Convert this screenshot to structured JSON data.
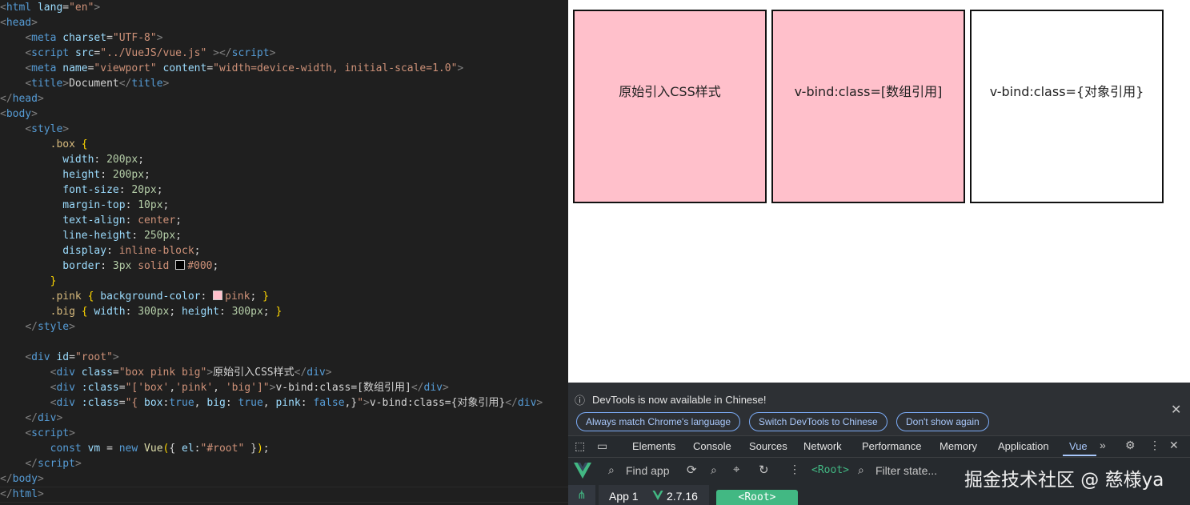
{
  "editor": {
    "lines": [
      [
        {
          "c": "br",
          "t": "<"
        },
        {
          "c": "tg",
          "t": "html"
        },
        {
          "c": "tx",
          "t": " "
        },
        {
          "c": "at",
          "t": "lang"
        },
        {
          "c": "tx",
          "t": "="
        },
        {
          "c": "st",
          "t": "\"en\""
        },
        {
          "c": "br",
          "t": ">"
        }
      ],
      [
        {
          "c": "br",
          "t": "<"
        },
        {
          "c": "tg",
          "t": "head"
        },
        {
          "c": "br",
          "t": ">"
        }
      ],
      [
        {
          "c": "tx",
          "t": "    "
        },
        {
          "c": "br",
          "t": "<"
        },
        {
          "c": "tg",
          "t": "meta"
        },
        {
          "c": "tx",
          "t": " "
        },
        {
          "c": "at",
          "t": "charset"
        },
        {
          "c": "tx",
          "t": "="
        },
        {
          "c": "st",
          "t": "\"UTF-8\""
        },
        {
          "c": "br",
          "t": ">"
        }
      ],
      [
        {
          "c": "tx",
          "t": "    "
        },
        {
          "c": "br",
          "t": "<"
        },
        {
          "c": "tg",
          "t": "script"
        },
        {
          "c": "tx",
          "t": " "
        },
        {
          "c": "at",
          "t": "src"
        },
        {
          "c": "tx",
          "t": "="
        },
        {
          "c": "st",
          "t": "\"../VueJS/vue.js\""
        },
        {
          "c": "tx",
          "t": " "
        },
        {
          "c": "br",
          "t": "></"
        },
        {
          "c": "tg",
          "t": "script"
        },
        {
          "c": "br",
          "t": ">"
        }
      ],
      [
        {
          "c": "tx",
          "t": "    "
        },
        {
          "c": "br",
          "t": "<"
        },
        {
          "c": "tg",
          "t": "meta"
        },
        {
          "c": "tx",
          "t": " "
        },
        {
          "c": "at",
          "t": "name"
        },
        {
          "c": "tx",
          "t": "="
        },
        {
          "c": "st",
          "t": "\"viewport\""
        },
        {
          "c": "tx",
          "t": " "
        },
        {
          "c": "at",
          "t": "content"
        },
        {
          "c": "tx",
          "t": "="
        },
        {
          "c": "st",
          "t": "\"width=device-width, initial-scale=1.0\""
        },
        {
          "c": "br",
          "t": ">"
        }
      ],
      [
        {
          "c": "tx",
          "t": "    "
        },
        {
          "c": "br",
          "t": "<"
        },
        {
          "c": "tg",
          "t": "title"
        },
        {
          "c": "br",
          "t": ">"
        },
        {
          "c": "tx",
          "t": "Document"
        },
        {
          "c": "br",
          "t": "</"
        },
        {
          "c": "tg",
          "t": "title"
        },
        {
          "c": "br",
          "t": ">"
        }
      ],
      [
        {
          "c": "br",
          "t": "</"
        },
        {
          "c": "tg",
          "t": "head"
        },
        {
          "c": "br",
          "t": ">"
        }
      ],
      [
        {
          "c": "br",
          "t": "<"
        },
        {
          "c": "tg",
          "t": "body"
        },
        {
          "c": "br",
          "t": ">"
        }
      ],
      [
        {
          "c": "tx",
          "t": "    "
        },
        {
          "c": "br",
          "t": "<"
        },
        {
          "c": "tg",
          "t": "style"
        },
        {
          "c": "br",
          "t": ">"
        }
      ],
      [
        {
          "c": "tx",
          "t": "        "
        },
        {
          "c": "sel",
          "t": ".box"
        },
        {
          "c": "tx",
          "t": " "
        },
        {
          "c": "pu",
          "t": "{"
        }
      ],
      [
        {
          "c": "tx",
          "t": "          "
        },
        {
          "c": "pr",
          "t": "width"
        },
        {
          "c": "tx",
          "t": ": "
        },
        {
          "c": "nu",
          "t": "200px"
        },
        {
          "c": "tx",
          "t": ";"
        }
      ],
      [
        {
          "c": "tx",
          "t": "          "
        },
        {
          "c": "pr",
          "t": "height"
        },
        {
          "c": "tx",
          "t": ": "
        },
        {
          "c": "nu",
          "t": "200px"
        },
        {
          "c": "tx",
          "t": ";"
        }
      ],
      [
        {
          "c": "tx",
          "t": "          "
        },
        {
          "c": "pr",
          "t": "font-size"
        },
        {
          "c": "tx",
          "t": ": "
        },
        {
          "c": "nu",
          "t": "20px"
        },
        {
          "c": "tx",
          "t": ";"
        }
      ],
      [
        {
          "c": "tx",
          "t": "          "
        },
        {
          "c": "pr",
          "t": "margin-top"
        },
        {
          "c": "tx",
          "t": ": "
        },
        {
          "c": "nu",
          "t": "10px"
        },
        {
          "c": "tx",
          "t": ";"
        }
      ],
      [
        {
          "c": "tx",
          "t": "          "
        },
        {
          "c": "pr",
          "t": "text-align"
        },
        {
          "c": "tx",
          "t": ": "
        },
        {
          "c": "vl",
          "t": "center"
        },
        {
          "c": "tx",
          "t": ";"
        }
      ],
      [
        {
          "c": "tx",
          "t": "          "
        },
        {
          "c": "pr",
          "t": "line-height"
        },
        {
          "c": "tx",
          "t": ": "
        },
        {
          "c": "nu",
          "t": "250px"
        },
        {
          "c": "tx",
          "t": ";"
        }
      ],
      [
        {
          "c": "tx",
          "t": "          "
        },
        {
          "c": "pr",
          "t": "display"
        },
        {
          "c": "tx",
          "t": ": "
        },
        {
          "c": "vl",
          "t": "inline-block"
        },
        {
          "c": "tx",
          "t": ";"
        }
      ],
      [
        {
          "c": "tx",
          "t": "          "
        },
        {
          "c": "pr",
          "t": "border"
        },
        {
          "c": "tx",
          "t": ": "
        },
        {
          "c": "nu",
          "t": "3px"
        },
        {
          "c": "tx",
          "t": " "
        },
        {
          "c": "vl",
          "t": "solid"
        },
        {
          "c": "tx",
          "t": " "
        },
        {
          "c": "sw",
          "t": "#000000"
        },
        {
          "c": "vl",
          "t": "#000"
        },
        {
          "c": "tx",
          "t": ";"
        }
      ],
      [
        {
          "c": "tx",
          "t": "        "
        },
        {
          "c": "pu",
          "t": "}"
        }
      ],
      [
        {
          "c": "tx",
          "t": "        "
        },
        {
          "c": "sel",
          "t": ".pink"
        },
        {
          "c": "tx",
          "t": " "
        },
        {
          "c": "pu",
          "t": "{"
        },
        {
          "c": "tx",
          "t": " "
        },
        {
          "c": "pr",
          "t": "background-color"
        },
        {
          "c": "tx",
          "t": ": "
        },
        {
          "c": "sw",
          "t": "#ffc0cb"
        },
        {
          "c": "vl",
          "t": "pink"
        },
        {
          "c": "tx",
          "t": "; "
        },
        {
          "c": "pu",
          "t": "}"
        }
      ],
      [
        {
          "c": "tx",
          "t": "        "
        },
        {
          "c": "sel",
          "t": ".big"
        },
        {
          "c": "tx",
          "t": " "
        },
        {
          "c": "pu",
          "t": "{"
        },
        {
          "c": "tx",
          "t": " "
        },
        {
          "c": "pr",
          "t": "width"
        },
        {
          "c": "tx",
          "t": ": "
        },
        {
          "c": "nu",
          "t": "300px"
        },
        {
          "c": "tx",
          "t": "; "
        },
        {
          "c": "pr",
          "t": "height"
        },
        {
          "c": "tx",
          "t": ": "
        },
        {
          "c": "nu",
          "t": "300px"
        },
        {
          "c": "tx",
          "t": "; "
        },
        {
          "c": "pu",
          "t": "}"
        }
      ],
      [
        {
          "c": "tx",
          "t": "    "
        },
        {
          "c": "br",
          "t": "</"
        },
        {
          "c": "tg",
          "t": "style"
        },
        {
          "c": "br",
          "t": ">"
        }
      ],
      [],
      [
        {
          "c": "tx",
          "t": "    "
        },
        {
          "c": "br",
          "t": "<"
        },
        {
          "c": "tg",
          "t": "div"
        },
        {
          "c": "tx",
          "t": " "
        },
        {
          "c": "at",
          "t": "id"
        },
        {
          "c": "tx",
          "t": "="
        },
        {
          "c": "st",
          "t": "\"root\""
        },
        {
          "c": "br",
          "t": ">"
        }
      ],
      [
        {
          "c": "tx",
          "t": "        "
        },
        {
          "c": "br",
          "t": "<"
        },
        {
          "c": "tg",
          "t": "div"
        },
        {
          "c": "tx",
          "t": " "
        },
        {
          "c": "at",
          "t": "class"
        },
        {
          "c": "tx",
          "t": "="
        },
        {
          "c": "st",
          "t": "\"box pink big\""
        },
        {
          "c": "br",
          "t": ">"
        },
        {
          "c": "tx",
          "t": "原始引入CSS样式"
        },
        {
          "c": "br",
          "t": "</"
        },
        {
          "c": "tg",
          "t": "div"
        },
        {
          "c": "br",
          "t": ">"
        }
      ],
      [
        {
          "c": "tx",
          "t": "        "
        },
        {
          "c": "br",
          "t": "<"
        },
        {
          "c": "tg",
          "t": "div"
        },
        {
          "c": "tx",
          "t": " "
        },
        {
          "c": "at",
          "t": ":class"
        },
        {
          "c": "tx",
          "t": "="
        },
        {
          "c": "st",
          "t": "\"["
        },
        {
          "c": "st",
          "t": "'box'"
        },
        {
          "c": "tx",
          "t": ","
        },
        {
          "c": "st",
          "t": "'pink'"
        },
        {
          "c": "tx",
          "t": ", "
        },
        {
          "c": "st",
          "t": "'big'"
        },
        {
          "c": "st",
          "t": "]\""
        },
        {
          "c": "br",
          "t": ">"
        },
        {
          "c": "tx",
          "t": "v-bind:class=[数组引用]"
        },
        {
          "c": "br",
          "t": "</"
        },
        {
          "c": "tg",
          "t": "div"
        },
        {
          "c": "br",
          "t": ">"
        }
      ],
      [
        {
          "c": "tx",
          "t": "        "
        },
        {
          "c": "br",
          "t": "<"
        },
        {
          "c": "tg",
          "t": "div"
        },
        {
          "c": "tx",
          "t": " "
        },
        {
          "c": "at",
          "t": ":class"
        },
        {
          "c": "tx",
          "t": "="
        },
        {
          "c": "st",
          "t": "\"{ "
        },
        {
          "c": "at",
          "t": "box"
        },
        {
          "c": "tx",
          "t": ":"
        },
        {
          "c": "kw",
          "t": "true"
        },
        {
          "c": "tx",
          "t": ", "
        },
        {
          "c": "at",
          "t": "big"
        },
        {
          "c": "tx",
          "t": ": "
        },
        {
          "c": "kw",
          "t": "true"
        },
        {
          "c": "tx",
          "t": ", "
        },
        {
          "c": "at",
          "t": "pink"
        },
        {
          "c": "tx",
          "t": ": "
        },
        {
          "c": "kw",
          "t": "false"
        },
        {
          "c": "tx",
          "t": ",}"
        },
        {
          "c": "st",
          "t": "\""
        },
        {
          "c": "br",
          "t": ">"
        },
        {
          "c": "tx",
          "t": "v-bind:class={对象引用}"
        },
        {
          "c": "br",
          "t": "</"
        },
        {
          "c": "tg",
          "t": "div"
        },
        {
          "c": "br",
          "t": ">"
        }
      ],
      [
        {
          "c": "tx",
          "t": "    "
        },
        {
          "c": "br",
          "t": "</"
        },
        {
          "c": "tg",
          "t": "div"
        },
        {
          "c": "br",
          "t": ">"
        }
      ],
      [
        {
          "c": "tx",
          "t": "    "
        },
        {
          "c": "br",
          "t": "<"
        },
        {
          "c": "tg",
          "t": "script"
        },
        {
          "c": "br",
          "t": ">"
        }
      ],
      [
        {
          "c": "tx",
          "t": "        "
        },
        {
          "c": "kw",
          "t": "const"
        },
        {
          "c": "tx",
          "t": " "
        },
        {
          "c": "at",
          "t": "vm"
        },
        {
          "c": "tx",
          "t": " = "
        },
        {
          "c": "kw",
          "t": "new"
        },
        {
          "c": "tx",
          "t": " "
        },
        {
          "c": "fn",
          "t": "Vue"
        },
        {
          "c": "pu",
          "t": "("
        },
        {
          "c": "tx",
          "t": "{ "
        },
        {
          "c": "at",
          "t": "el"
        },
        {
          "c": "tx",
          "t": ":"
        },
        {
          "c": "st",
          "t": "\"#root\""
        },
        {
          "c": "tx",
          "t": " }"
        },
        {
          "c": "pu",
          "t": ")"
        },
        {
          "c": "tx",
          "t": ";"
        }
      ],
      [
        {
          "c": "tx",
          "t": "    "
        },
        {
          "c": "br",
          "t": "</"
        },
        {
          "c": "tg",
          "t": "script"
        },
        {
          "c": "br",
          "t": ">"
        }
      ],
      [
        {
          "c": "br",
          "t": "</"
        },
        {
          "c": "tg",
          "t": "body"
        },
        {
          "c": "br",
          "t": ">"
        }
      ],
      [
        {
          "c": "br",
          "t": "</"
        },
        {
          "c": "tg",
          "t": "html"
        },
        {
          "c": "br",
          "t": ">"
        }
      ]
    ]
  },
  "preview": {
    "box1": "原始引入CSS样式",
    "box2": "v-bind:class=[数组引用]",
    "box3": "v-bind:class={对象引用}",
    "pink_color": "#ffc0cb"
  },
  "devtools": {
    "info_message": "DevTools is now available in Chinese!",
    "btn_match": "Always match Chrome's language",
    "btn_switch": "Switch DevTools to Chinese",
    "btn_dont_show": "Don't show again",
    "tabs": [
      "Elements",
      "Console",
      "Sources",
      "Network",
      "Performance",
      "Memory",
      "Application",
      "Vue"
    ],
    "active_tab": "Vue",
    "find_app_placeholder": "Find app",
    "root_label": "<Root>",
    "filter_placeholder": "Filter state...",
    "app_name": "App 1",
    "vue_version": "2.7.16",
    "root_badge": "<Root>",
    "watermark": "掘金技术社区 @ 慈様ya",
    "accent_color": "#42b883"
  }
}
